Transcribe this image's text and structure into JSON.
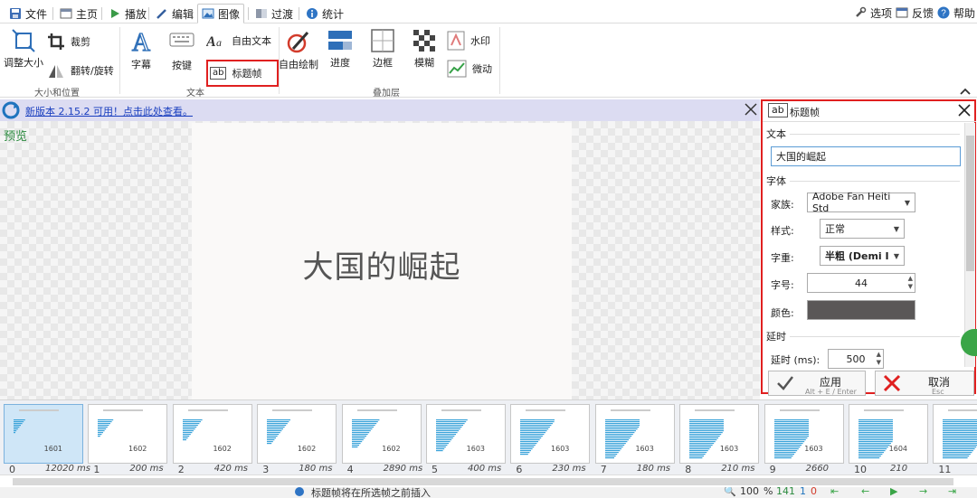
{
  "tabs": [
    {
      "label": "文件",
      "icon": "save-icon"
    },
    {
      "label": "主页",
      "icon": "home-icon"
    },
    {
      "label": "播放",
      "icon": "play-icon"
    },
    {
      "label": "编辑",
      "icon": "pencil-icon"
    },
    {
      "label": "图像",
      "icon": "image-icon"
    },
    {
      "label": "过渡",
      "icon": "transition-icon"
    },
    {
      "label": "统计",
      "icon": "info-icon"
    }
  ],
  "right_menu": {
    "options": "选项",
    "feedback": "反馈",
    "help": "帮助"
  },
  "ribbon": {
    "resize": "调整大小",
    "crop": "裁剪",
    "flip_rotate": "翻转/旋转",
    "group_size": "大小和位置",
    "caption": "字幕",
    "keystrokes": "按键",
    "free_text": "自由文本",
    "title_frame": "标题帧",
    "group_text": "文本",
    "free_drawing": "自由绘制",
    "progress": "进度",
    "border": "边框",
    "blur": "模糊",
    "watermark": "水印",
    "cinemagraph": "微动",
    "group_overlay": "叠加层"
  },
  "notification": "新版本 2.15.2 可用！点击此处查看。",
  "preview": {
    "label": "预览",
    "canvas_title": "大国的崛起"
  },
  "panel": {
    "title": "标题帧",
    "icon_text": "ab",
    "section_text": "文本",
    "text_value": "大国的崛起",
    "section_font": "字体",
    "family_label": "家族:",
    "family_value": "Adobe Fan Heiti Std",
    "style_label": "样式:",
    "style_value": "正常",
    "weight_label": "字重:",
    "weight_value": "半粗 (Demi I",
    "size_label": "字号:",
    "size_value": "44",
    "color_label": "颜色:",
    "color_value": "#5a5757",
    "section_delay": "延时",
    "delay_label": "延时 (ms):",
    "delay_value": "500",
    "apply_label": "应用",
    "apply_hint": "Alt + E / Enter",
    "cancel_label": "取消",
    "cancel_hint": "Esc"
  },
  "frames": [
    {
      "index": "0",
      "duration": "12020 ms",
      "thumb_num": "1601"
    },
    {
      "index": "1",
      "duration": "200 ms",
      "thumb_num": "1602"
    },
    {
      "index": "2",
      "duration": "420 ms",
      "thumb_num": "1602"
    },
    {
      "index": "3",
      "duration": "180 ms",
      "thumb_num": "1602"
    },
    {
      "index": "4",
      "duration": "2890 ms",
      "thumb_num": "1602"
    },
    {
      "index": "5",
      "duration": "400 ms",
      "thumb_num": "1603"
    },
    {
      "index": "6",
      "duration": "230 ms",
      "thumb_num": "1603"
    },
    {
      "index": "7",
      "duration": "180 ms",
      "thumb_num": "1603"
    },
    {
      "index": "8",
      "duration": "210 ms",
      "thumb_num": "1603"
    },
    {
      "index": "9",
      "duration": "2660",
      "thumb_num": "1603"
    },
    {
      "index": "10",
      "duration": "210",
      "thumb_num": "1604"
    },
    {
      "index": "11",
      "duration": "",
      "thumb_num": ""
    }
  ],
  "status": {
    "message": "标题帧将在所选帧之前插入",
    "zoom": "100",
    "zoom_unit": "%",
    "frame_count": "141",
    "selected_count": "1",
    "other_count": "0"
  },
  "colors": {
    "accent": "#1e73be",
    "highlight_red": "#e02020",
    "preview_label": "#2b8a3e"
  }
}
